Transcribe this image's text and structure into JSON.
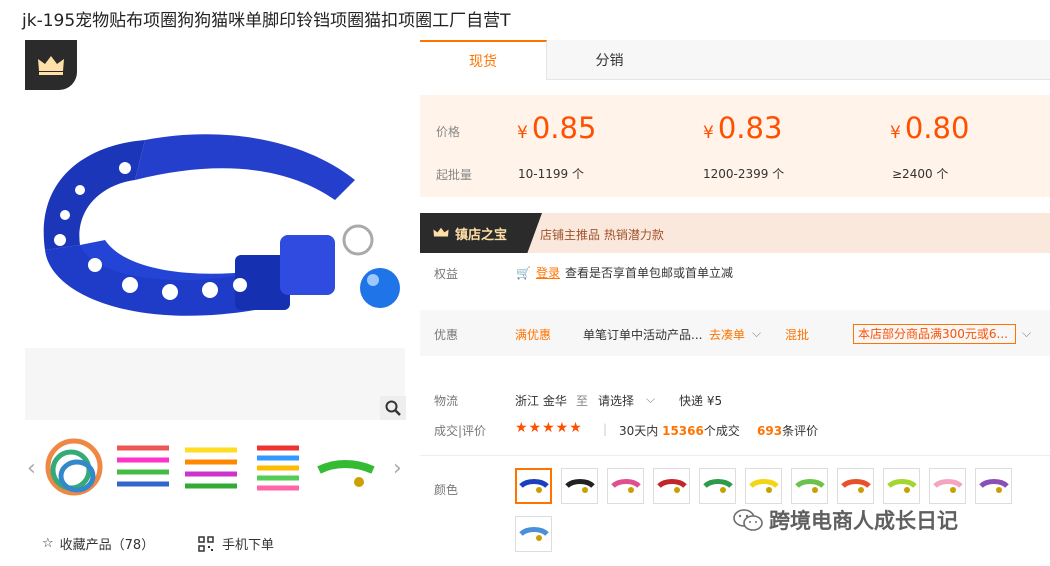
{
  "product_title": "jk-195宠物贴布项圈狗狗猫咪单脚印铃铛项圈猫扣项圈工厂自营T",
  "tabs": [
    {
      "label": "现货"
    },
    {
      "label": "分销"
    }
  ],
  "pricing": {
    "price_label": "价格",
    "moq_label": "起批量",
    "currency": "¥",
    "tiers": [
      {
        "price": "0.85",
        "range": "10-1199 个"
      },
      {
        "price": "0.83",
        "range": "1200-2399 个"
      },
      {
        "price": "0.80",
        "range": "≥2400 个"
      }
    ]
  },
  "treasure": {
    "badge": "镇店之宝",
    "text": "店铺主推品  热销潜力款"
  },
  "benefits": {
    "label": "权益",
    "login": "登录",
    "text": "查看是否享首单包邮或首单立减"
  },
  "promo": {
    "label": "优惠",
    "full_discount": "满优惠",
    "desc": "单笔订单中活动产品...",
    "link": "去凑单",
    "mix": "混批",
    "coupon": "本店部分商品满300元或6..."
  },
  "logistics": {
    "label": "物流",
    "origin": "浙江 金华",
    "to": "至",
    "dest": "请选择",
    "express": "快递 ¥5"
  },
  "deals": {
    "label": "成交|评价",
    "stars": "★★★★★",
    "period": "30天内",
    "count": "15366",
    "count_unit": "个成交",
    "reviews": "693",
    "reviews_unit": "条评价"
  },
  "color_label": "颜色",
  "colors": [
    "#1a3fbf",
    "#222222",
    "#e0508e",
    "#c0262a",
    "#2f9a4a",
    "#f2d516",
    "#6cc24a",
    "#e8502a",
    "#a4d630",
    "#f4a6c0",
    "#8a4fb5",
    "#4a90d9"
  ],
  "gallery": {
    "collect": "收藏产品（78）",
    "mobile": "手机下单"
  },
  "watermark": "跨境电商人成长日记",
  "accent": "#ff7300"
}
